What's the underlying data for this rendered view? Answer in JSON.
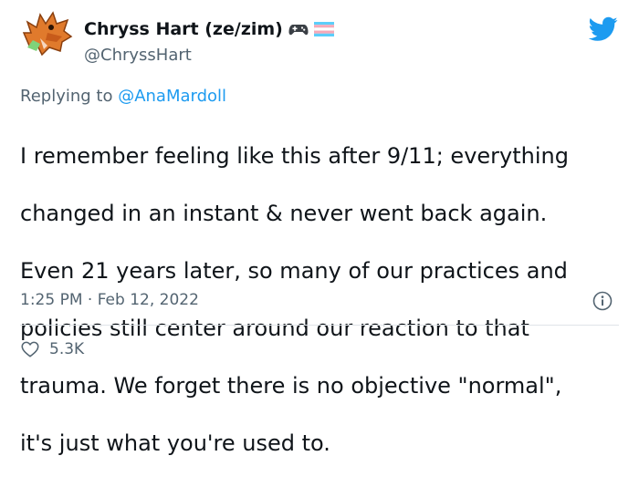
{
  "author": {
    "display_name": "Chryss Hart (ze/zim)",
    "handle": "@ChryssHart",
    "avatar_icon": "dragon-avatar-icon",
    "badges": [
      "gamepad-emoji-icon",
      "transgender-flag-emoji-icon"
    ]
  },
  "reply": {
    "prefix": "Replying to ",
    "to_handle": "@AnaMardoll"
  },
  "tweet": {
    "text_lines": [
      "I remember feeling like this after 9/11; everything",
      "changed in an instant & never went back again.",
      "Even 21 years later, so many of our practices and",
      "policies still center around our reaction to that",
      "trauma. We forget there is no objective \"normal\",",
      "it's just what you're used to."
    ],
    "timestamp": "1:25 PM · Feb 12, 2022"
  },
  "engagement": {
    "likes": "5.3K"
  },
  "colors": {
    "brand_blue": "#1d9bf0",
    "text": "#0f1419",
    "secondary": "#536471"
  }
}
